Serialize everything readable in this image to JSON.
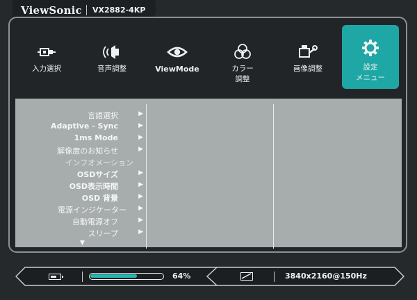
{
  "header": {
    "brand": "ViewSonic",
    "model": "VX2882-4KP"
  },
  "tabs": [
    {
      "name": "input",
      "label": "入力選択",
      "icon": "input-source-icon",
      "active": false
    },
    {
      "name": "audio",
      "label": "音声調整",
      "icon": "speaker-icon",
      "active": false
    },
    {
      "name": "viewmode",
      "label": "ViewMode",
      "icon": "eye-icon",
      "active": false
    },
    {
      "name": "color",
      "label": "カラー\n調整",
      "icon": "color-circles-icon",
      "active": false
    },
    {
      "name": "image",
      "label": "画像調整",
      "icon": "image-adjust-icon",
      "active": false
    },
    {
      "name": "setup",
      "label": "設定\nメニュー",
      "icon": "gear-icon",
      "active": true
    }
  ],
  "menu": {
    "items": [
      {
        "label": "言語選択",
        "arrow": true,
        "bold": false,
        "enabled": true
      },
      {
        "label": "Adaptive - Sync",
        "arrow": true,
        "bold": true,
        "enabled": true
      },
      {
        "label": "1ms Mode",
        "arrow": true,
        "bold": true,
        "enabled": true
      },
      {
        "label": "解像度のお知らせ",
        "arrow": true,
        "bold": false,
        "enabled": true
      },
      {
        "label": "インフオメーション",
        "arrow": false,
        "bold": false,
        "enabled": false
      },
      {
        "label": "OSDサイズ",
        "arrow": true,
        "bold": true,
        "enabled": true
      },
      {
        "label": "OSD表示時間",
        "arrow": true,
        "bold": true,
        "enabled": true
      },
      {
        "label": "OSD 背景",
        "arrow": true,
        "bold": true,
        "enabled": true
      },
      {
        "label": "電源インジケーター",
        "arrow": true,
        "bold": false,
        "enabled": true
      },
      {
        "label": "自動電源オフ",
        "arrow": true,
        "bold": false,
        "enabled": true
      },
      {
        "label": "スリープ",
        "arrow": true,
        "bold": false,
        "enabled": true
      }
    ],
    "arrow_glyph": "▶",
    "more_glyph": "▼"
  },
  "status": {
    "battery_icon": "battery-icon",
    "progress": 64,
    "progress_label": "64%",
    "signal_icon": "signal-icon",
    "resolution": "3840x2160@150Hz"
  },
  "colors": {
    "accent": "#1ea7a5",
    "panel": "#a7acad",
    "background": "#26292b"
  }
}
